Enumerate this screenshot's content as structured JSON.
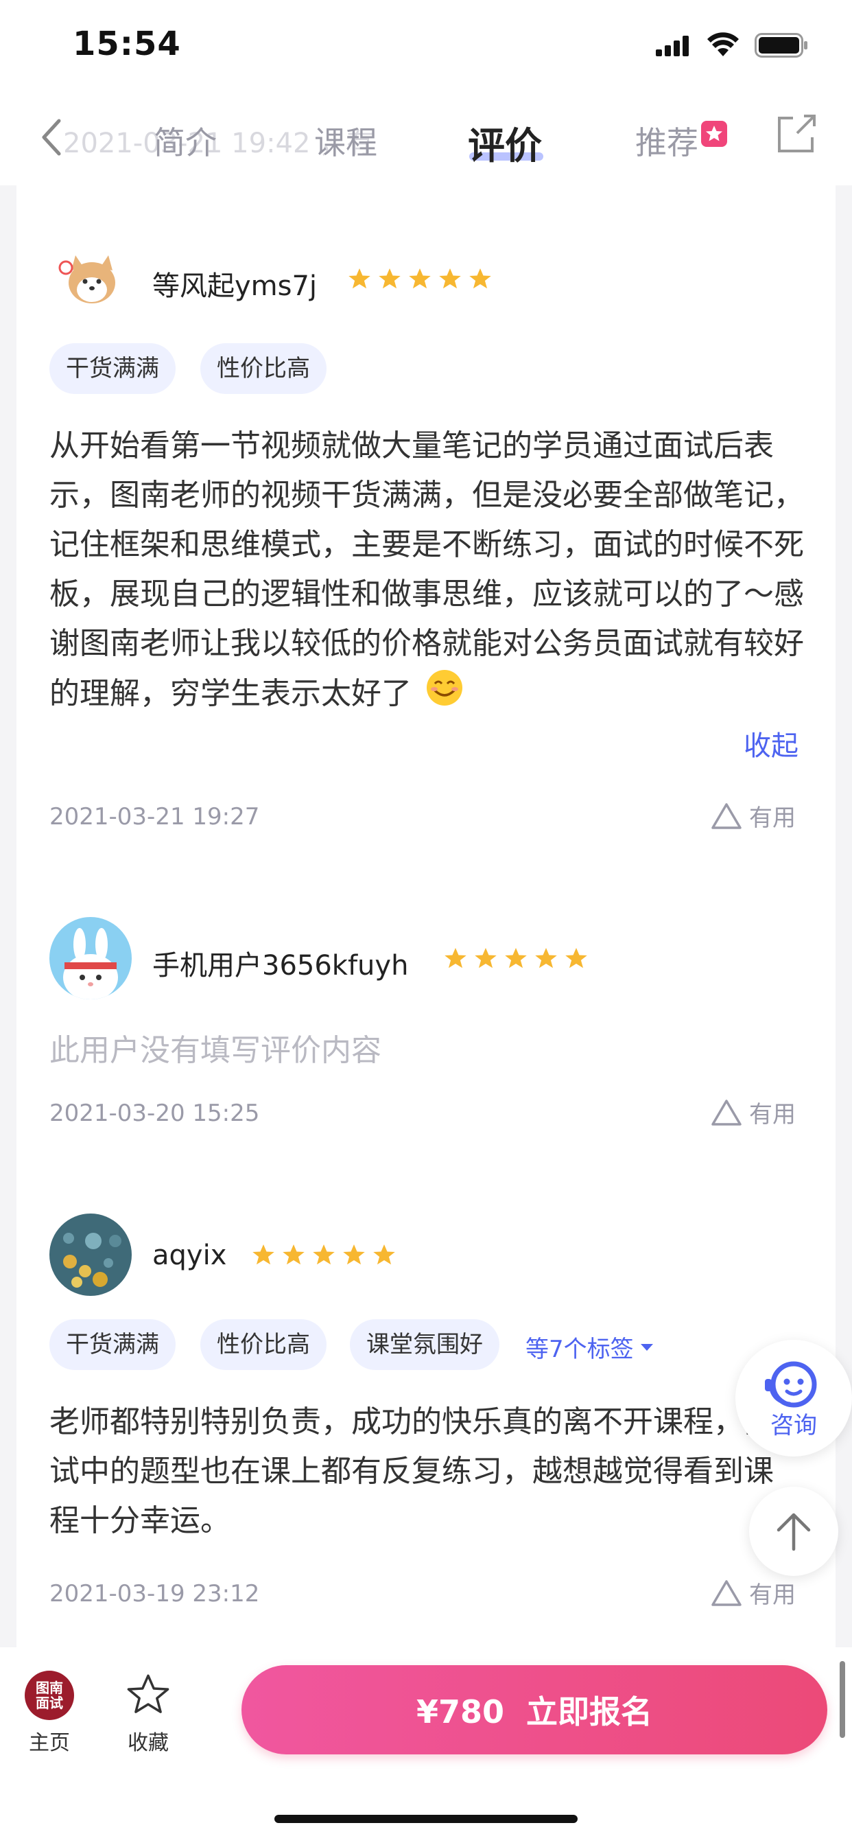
{
  "status_bar": {
    "time": "15:54"
  },
  "nav": {
    "back_icon": "chevron-left-icon",
    "faded_text": "2021-03-21 19:42 ，有",
    "tabs": [
      {
        "label": "简介",
        "active": false
      },
      {
        "label": "课程",
        "active": false
      },
      {
        "label": "评价",
        "active": true
      },
      {
        "label": "推荐",
        "active": false,
        "badge": "red-star-badge"
      }
    ],
    "share_icon": "share-icon"
  },
  "reviews": [
    {
      "user": "等风起yms7j",
      "stars": 5,
      "tags": [
        "干货满满",
        "性价比高"
      ],
      "content": "从开始看第一节视频就做大量笔记的学员通过面试后表示，图南老师的视频干货满满，但是没必要全部做笔记，记住框架和思维模式，主要是不断练习，面试的时候不死板，展现自己的逻辑性和做事思维，应该就可以的了～感谢图南老师让我以较低的价格就能对公务员面试就有较好的理解，穷学生表示太好了",
      "collapse_label": "收起",
      "date": "2021-03-21 19:27",
      "useful_label": "有用"
    },
    {
      "user": "手机用户3656kfuyh",
      "stars": 5,
      "empty_text": "此用户没有填写评价内容",
      "date": "2021-03-20 15:25",
      "useful_label": "有用"
    },
    {
      "user": "aqyix",
      "stars": 5,
      "tags": [
        "干货满满",
        "性价比高",
        "课堂氛围好"
      ],
      "more_tags_label": "等7个标签",
      "content": "老师都特别特别负责，成功的快乐真的离不开课程，面试中的题型也在课上都有反复练习，越想越觉得看到课程十分幸运。",
      "date": "2021-03-19 23:12",
      "useful_label": "有用"
    }
  ],
  "floating": {
    "consult_label": "咨询"
  },
  "bottom_bar": {
    "home_logo_text": "图南\n面试",
    "home_label": "主页",
    "favorite_label": "收藏",
    "enroll_label": "¥780  立即报名"
  },
  "colors": {
    "accent": "#4d63f0",
    "star": "#f7b731",
    "enroll": "#ec4a78"
  }
}
